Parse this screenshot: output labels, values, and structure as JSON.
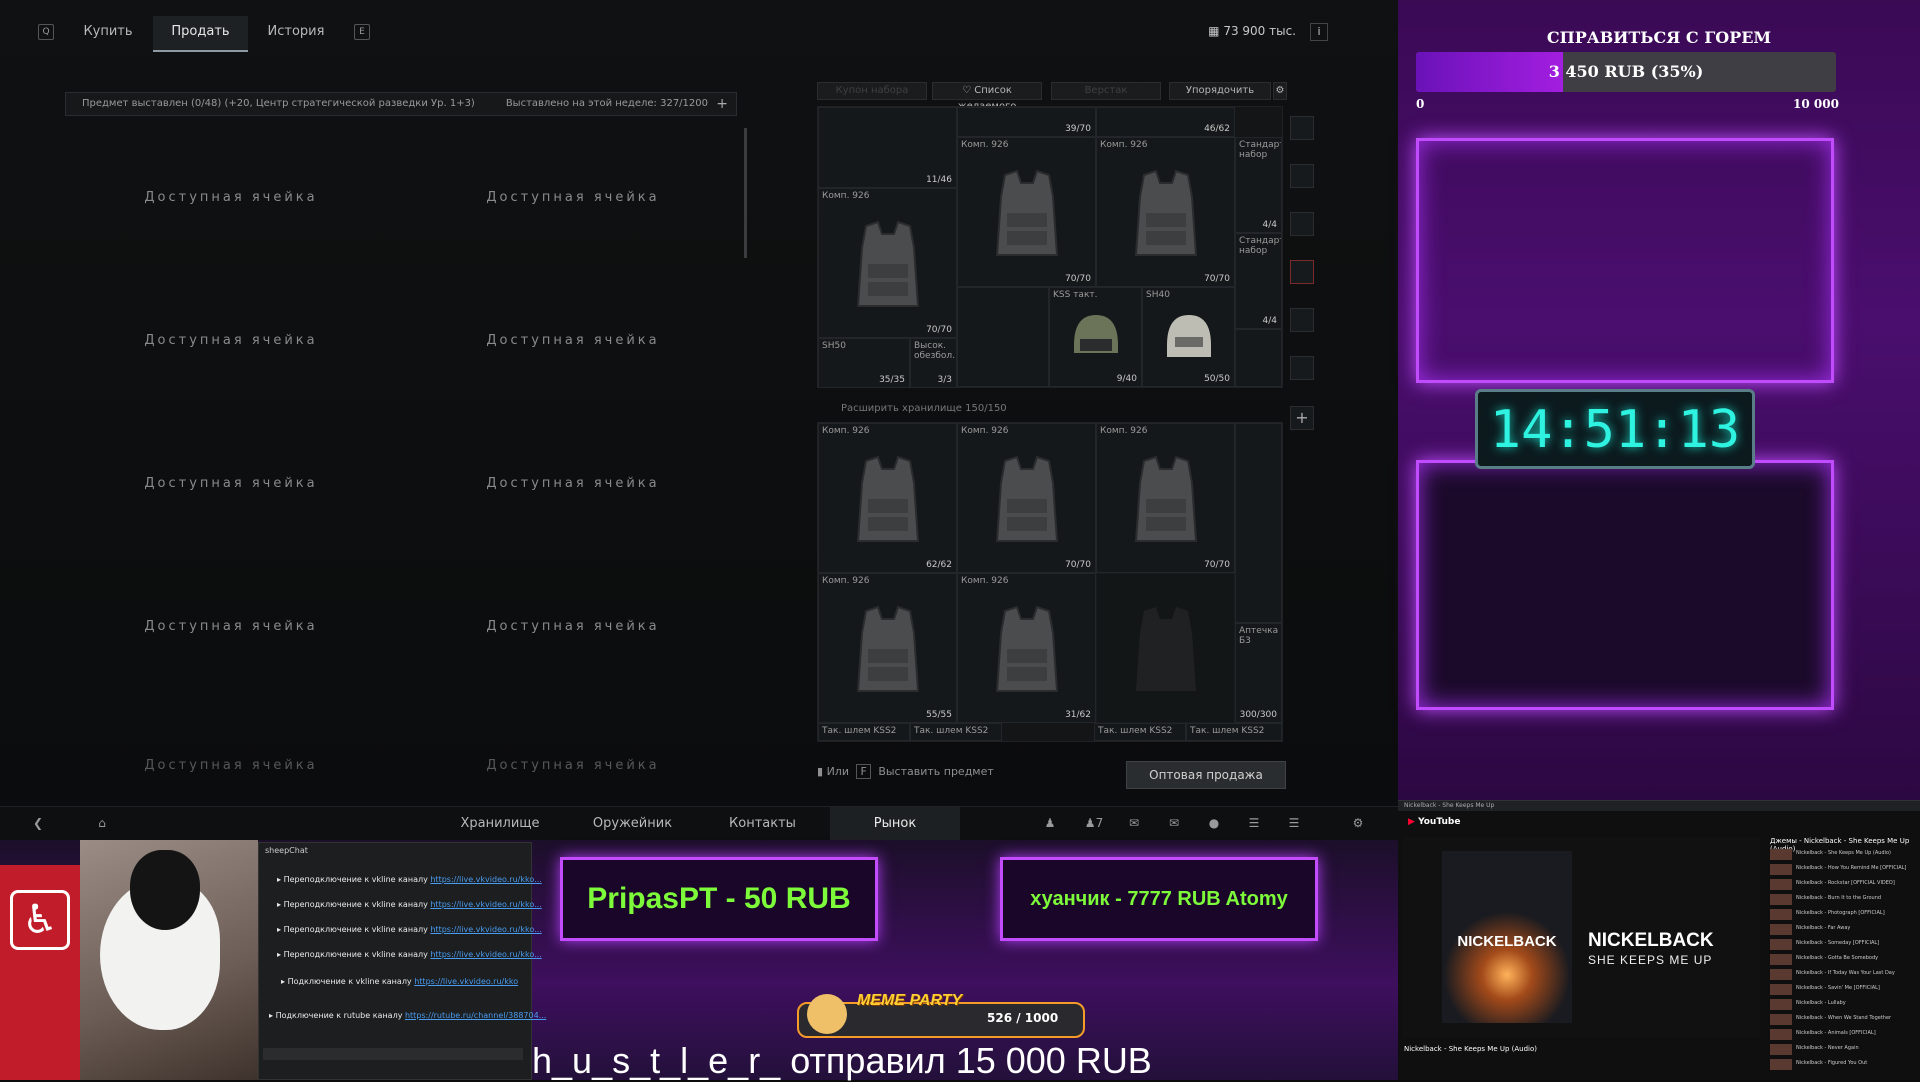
{
  "game": {
    "keyhint_left": "Q",
    "keyhint_right": "E",
    "tabs": [
      "Купить",
      "Продать",
      "История"
    ],
    "active_tab": "Продать",
    "money": "73 900 тыс.",
    "info_btn": "i",
    "infobar_left": "Предмет выставлен (0/48)  (+20, Центр стратегической разведки Ур. 1+3)",
    "infobar_right": "Выставлено на этой неделе: 327/1200",
    "infobar_plus": "+",
    "slot_label": "Доступная ячейка",
    "stash_buttons": [
      "Купон набора",
      "♡ Список желаемого",
      "Верстак",
      "Упорядочить"
    ],
    "top_grid": [
      {
        "label": "",
        "count": "11/46"
      },
      {
        "label": "",
        "count": "39/70"
      },
      {
        "label": "",
        "count": "46/62"
      },
      {
        "label": "Комп. 926",
        "count": "70/70"
      },
      {
        "label": "Комп. 926",
        "count": "70/70"
      },
      {
        "label": "Комп. 926",
        "count": "70/70"
      },
      {
        "label": "Стандарт. набор",
        "count": "4/4"
      },
      {
        "label": "Стандарт. набор",
        "count": "4/4"
      },
      {
        "label": "KSS такт.",
        "count": "9/40"
      },
      {
        "label": "SH40",
        "count": "50/50"
      },
      {
        "label": "SH50",
        "count": "35/35"
      },
      {
        "label": "Высок. обезбол.",
        "count": "3/3"
      }
    ],
    "expand_label": "Расширить хранилище  150/150",
    "bottom_grid": [
      {
        "label": "Комп. 926",
        "count": "62/62"
      },
      {
        "label": "Комп. 926",
        "count": "70/70"
      },
      {
        "label": "Комп. 926",
        "count": "70/70"
      },
      {
        "label": "Комп. 926",
        "count": "55/55"
      },
      {
        "label": "Комп. 926",
        "count": "31/62"
      },
      {
        "label": "Аптечка Б3",
        "count": "300/300"
      }
    ],
    "bottom_row_labels": [
      "Так. шлем KSS2",
      "Так. шлем KSS2",
      "Так. шлем KSS2",
      "Так. шлем KSS2"
    ],
    "list_hint_or": "Или",
    "list_hint_key": "F",
    "list_hint_action": "Выставить предмет",
    "wholesale_button": "Оптовая продажа",
    "nav": [
      "Хранилище",
      "Оружейник",
      "Контакты",
      "Рынок"
    ],
    "nav_active": "Рынок",
    "nav_count": "7"
  },
  "donation": {
    "goal_title": "СПРАВИТЬСЯ С ГОРЕМ",
    "goal_text": "3 450 RUB (35%)",
    "goal_progress": 0.35,
    "goal_min": "0",
    "goal_max": "10 000",
    "clock": "14:51:13"
  },
  "overlay": {
    "chat_title": "sheepChat",
    "chat_lines": [
      {
        "text": "Переподключение к vkline каналу ",
        "url": "https://live.vkvideo.ru/kko..."
      },
      {
        "text": "Переподключение к vkline каналу ",
        "url": "https://live.vkvideo.ru/kko..."
      },
      {
        "text": "Переподключение к vkline каналу ",
        "url": "https://live.vkvideo.ru/kko..."
      },
      {
        "text": "Переподключение к vkline каналу ",
        "url": "https://live.vkvideo.ru/kko..."
      },
      {
        "text": "Подключение к vkline каналу ",
        "url": "https://live.vkvideo.ru/kko"
      },
      {
        "text": "Подключение к rutube каналу ",
        "url": "https://rutube.ru/channel/388704..."
      }
    ],
    "donor1": "PripasPT - 50 RUB",
    "donor2": "хуанчик - 7777 RUB   Atomy",
    "meme_title": "MEME PARTY",
    "meme_count": "526 / 1000",
    "alert": "h_u_s_t_l_e_r_ отправил 15 000 RUB"
  },
  "youtube": {
    "tabs": "Nickelback - She Keeps Me Up",
    "logo": "YouTube",
    "art_band": "NICKELBACK",
    "art_song": "SHE KEEPS ME UP",
    "caption": "Nickelback - She Keeps Me Up (Audio)",
    "list_title": "Джемы - Nickelback - She Keeps Me Up (Audio)",
    "list_items": [
      "Nickelback - She Keeps Me Up (Audio)",
      "Nickelback - How You Remind Me [OFFICIAL]",
      "Nickelback - Rockstar [OFFICIAL VIDEO]",
      "Nickelback - Burn It to the Ground",
      "Nickelback - Photograph [OFFICIAL]",
      "Nickelback - Far Away",
      "Nickelback - Someday [OFFICIAL]",
      "Nickelback - Gotta Be Somebody",
      "Nickelback - If Today Was Your Last Day",
      "Nickelback - Savin' Me [OFFICIAL]",
      "Nickelback - Lullaby",
      "Nickelback - When We Stand Together",
      "Nickelback - Animals [OFFICIAL]",
      "Nickelback - Never Again",
      "Nickelback - Figured You Out"
    ]
  }
}
